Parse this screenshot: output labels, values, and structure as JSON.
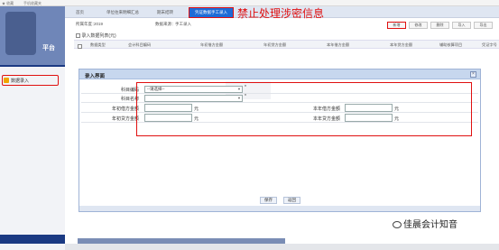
{
  "browser_strip": {
    "items": [
      "★ 收藏",
      "手机收藏夹"
    ]
  },
  "sidebar": {
    "logo_suffix": "平台",
    "menu_item_label": "数据录入"
  },
  "tabs": [
    "首页",
    "单位往来明细汇总",
    "期末结转",
    "凭证数据手工录入"
  ],
  "warning": "禁止处理涉密信息",
  "filters": {
    "year_label": "所属年度：",
    "year_value": "2019",
    "source_label": "数据来源：",
    "source_value": "手工录入"
  },
  "toolbar": [
    "新增",
    "修改",
    "删除",
    "导入",
    "导出"
  ],
  "list": {
    "subhead": "录入数据列表(元)",
    "columns": [
      "数据类型",
      "会计科目编码",
      "年初借方金额",
      "年初贷方金额",
      "本年借方金额",
      "本年贷方金额",
      "辅助核算项目",
      "凭证字号"
    ]
  },
  "dialog": {
    "title": "录入界面",
    "close": "×",
    "subject_code_label": "科目编码",
    "subject_name_label": "科目名称",
    "select_placeholder": "--请选择--",
    "required_mark": "*",
    "begin_debit_label": "年初借方金额",
    "begin_credit_label": "年初贷方金额",
    "year_debit_label": "本年借方金额",
    "year_credit_label": "本年贷方金额",
    "unit": "元",
    "save": "保存",
    "back": "返回"
  },
  "watermark": "佳晨会计知音",
  "colors": {
    "accent": "#1e6bd6",
    "sidebar": "#1b3a83",
    "highlight": "#e01010"
  }
}
